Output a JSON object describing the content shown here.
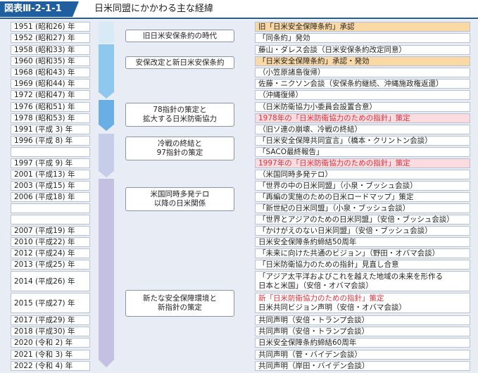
{
  "header": {
    "figure_label": "図表Ⅲ-2-1-1",
    "title": "日米同盟にかかわる主な経緯"
  },
  "rows": [
    {
      "year": "1951 (昭和26) 年",
      "event_lines": [
        "旧「日米安全保障条約」承認"
      ],
      "highlight": "orange",
      "red": false
    },
    {
      "year": "1952 (昭和27) 年",
      "event_lines": [
        "「同条約」発効"
      ],
      "highlight": "",
      "red": false
    },
    {
      "year": "1958 (昭和33) 年",
      "event_lines": [
        "藤山・ダレス会談（日米安保条約改定同意）"
      ],
      "highlight": "",
      "red": false
    },
    {
      "year": "1960 (昭和35) 年",
      "event_lines": [
        "「日米安全保障条約」承認・発効"
      ],
      "highlight": "orange",
      "red": false
    },
    {
      "year": "1968 (昭和43) 年",
      "event_lines": [
        "（小笠原諸島復帰）"
      ],
      "highlight": "",
      "red": false
    },
    {
      "year": "1969 (昭和44) 年",
      "event_lines": [
        "佐藤・ニクソン会談（安保条約継続、沖縄施政権返還）"
      ],
      "highlight": "",
      "red": false
    },
    {
      "year": "1972 (昭和47) 年",
      "event_lines": [
        "（沖縄復帰）"
      ],
      "highlight": "",
      "red": false
    },
    {
      "year": "1976 (昭和51) 年",
      "event_lines": [
        "（日米防衛協力小委員会設置合意）"
      ],
      "highlight": "",
      "red": false
    },
    {
      "year": "1978 (昭和53) 年",
      "event_lines": [
        "1978年の「日米防衛協力のための指針」策定"
      ],
      "highlight": "pink",
      "red": true
    },
    {
      "year": "1991 (平成 3) 年",
      "event_lines": [
        "（旧ソ連の崩壊、冷戦の終結）"
      ],
      "highlight": "",
      "red": false
    },
    {
      "year": "1996 (平成 8) 年",
      "event_lines": [
        "「日米安全保障共同宣言」（橋本・クリントン会談）"
      ],
      "highlight": "",
      "red": false
    },
    {
      "year": "",
      "event_lines": [
        "「SACO最終報告」"
      ],
      "highlight": "",
      "red": false
    },
    {
      "year": "1997 (平成 9) 年",
      "event_lines": [
        "1997年の「日米防衛協力のための指針」策定"
      ],
      "highlight": "pink",
      "red": true
    },
    {
      "year": "2001 (平成13) 年",
      "event_lines": [
        "（米国同時多発テロ）"
      ],
      "highlight": "",
      "red": false
    },
    {
      "year": "2003 (平成15) 年",
      "event_lines": [
        "「世界の中の日米同盟」（小泉・ブッシュ会談）"
      ],
      "highlight": "",
      "red": false
    },
    {
      "year": "2006 (平成18) 年",
      "event_lines": [
        "「再編の実施のための日米ロードマップ」策定"
      ],
      "highlight": "",
      "red": false
    },
    {
      "year": "",
      "event_lines": [
        "「新世紀の日米同盟」（小泉・ブッシュ会談）"
      ],
      "highlight": "",
      "red": false
    },
    {
      "year": "",
      "event_lines": [
        "「世界とアジアのための日米同盟」（安倍・ブッシュ会談）"
      ],
      "highlight": "",
      "red": false
    },
    {
      "year": "2007 (平成19) 年",
      "event_lines": [
        "「かけがえのない日米同盟」（安倍・ブッシュ会談）"
      ],
      "highlight": "",
      "red": false
    },
    {
      "year": "2010 (平成22) 年",
      "event_lines": [
        "日米安全保障条約締結50周年"
      ],
      "highlight": "",
      "red": false
    },
    {
      "year": "2012 (平成24) 年",
      "event_lines": [
        "「未来に向けた共通のビジョン」（野田・オバマ会談）"
      ],
      "highlight": "",
      "red": false
    },
    {
      "year": "2013 (平成25) 年",
      "event_lines": [
        "「日米防衛協力のための指針」見直し合意"
      ],
      "highlight": "",
      "red": false
    },
    {
      "year": "2014 (平成26) 年",
      "event_lines": [
        "「アジア太平洋およびこれを越えた地域の未来を形作る",
        "日本と米国」（安倍・オバマ会談）"
      ],
      "highlight": "",
      "red": false
    },
    {
      "year": "2015 (平成27) 年",
      "event_lines": [
        "新「日米防衛協力のための指針」策定",
        "日米共同ビジョン声明（安倍・オバマ会談）"
      ],
      "highlight": "",
      "red": "first"
    },
    {
      "year": "2017 (平成29) 年",
      "event_lines": [
        "共同声明（安倍・トランプ会談）"
      ],
      "highlight": "",
      "red": false
    },
    {
      "year": "2018 (平成30) 年",
      "event_lines": [
        "共同声明（安倍・トランプ会談）"
      ],
      "highlight": "",
      "red": false
    },
    {
      "year": "2020 (令和 2) 年",
      "event_lines": [
        "日米安全保障条約締結60周年"
      ],
      "highlight": "",
      "red": false
    },
    {
      "year": "2021 (令和 3) 年",
      "event_lines": [
        "共同声明（菅・バイデン会談）"
      ],
      "highlight": "",
      "red": false
    },
    {
      "year": "2022 (令和 4) 年",
      "event_lines": [
        "共同声明（岸田・バイデン会談）"
      ],
      "highlight": "",
      "red": false
    }
  ],
  "eras": [
    {
      "lines": [
        "旧日米安保条約の時代"
      ],
      "color": "#d9eaf7"
    },
    {
      "lines": [
        "安保改定と新日米安保条約"
      ],
      "color": "#8fc8ef"
    },
    {
      "lines": [
        "78指針の策定と",
        "拡大する日米防衛協力"
      ],
      "color": "#6aaee6"
    },
    {
      "lines": [
        "冷戦の終結と",
        "97指針の策定"
      ],
      "color": "#c6cde9"
    },
    {
      "lines": [
        "米国同時多発テロ",
        "以降の日米関係"
      ],
      "color": "#c3c0e2"
    },
    {
      "lines": [
        "新たな安全保障環境と",
        "新指針の策定"
      ],
      "color": "#c3c0e2"
    }
  ]
}
